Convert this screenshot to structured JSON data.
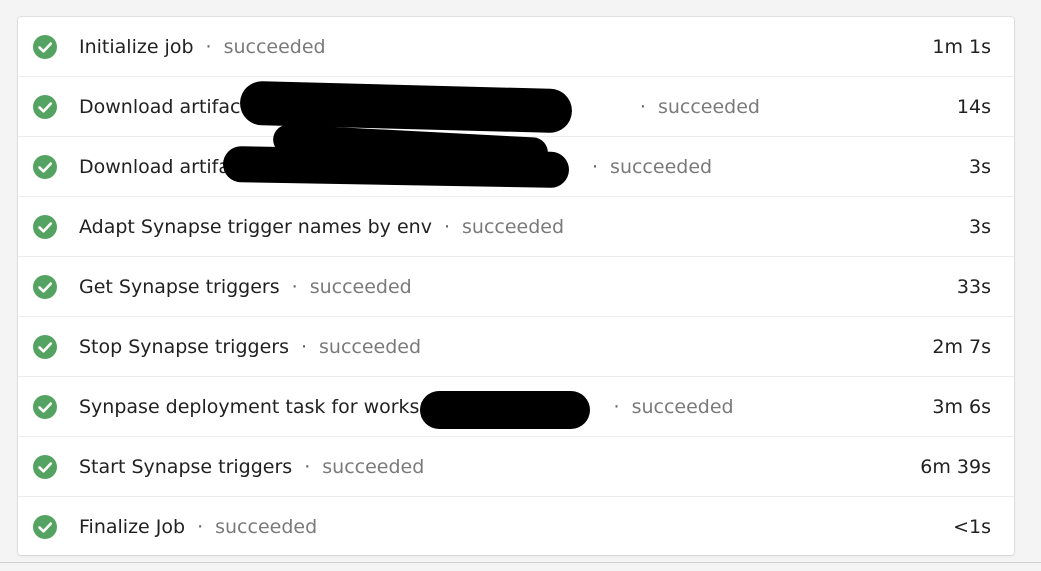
{
  "steps": [
    {
      "name": "Initialize job",
      "status": "succeeded",
      "duration": "1m 1s"
    },
    {
      "name": "Download artifact",
      "status": "succeeded",
      "duration": "14s"
    },
    {
      "name": "Download artifa",
      "status": "succeeded",
      "duration": "3s"
    },
    {
      "name": "Adapt Synapse trigger names by env",
      "status": "succeeded",
      "duration": "3s"
    },
    {
      "name": "Get Synapse triggers",
      "status": "succeeded",
      "duration": "33s"
    },
    {
      "name": "Stop Synapse triggers",
      "status": "succeeded",
      "duration": "2m 7s"
    },
    {
      "name": "Synpase deployment task for worksp",
      "status": "succeeded",
      "duration": "3m 6s"
    },
    {
      "name": "Start Synapse triggers",
      "status": "succeeded",
      "duration": "6m 39s"
    },
    {
      "name": "Finalize Job",
      "status": "succeeded",
      "duration": "<1s"
    }
  ],
  "separator": "·",
  "colors": {
    "success": "#55a362",
    "text": "#212121",
    "muted": "#7a7a7a"
  },
  "icons": {
    "status": "check-circle-icon"
  }
}
